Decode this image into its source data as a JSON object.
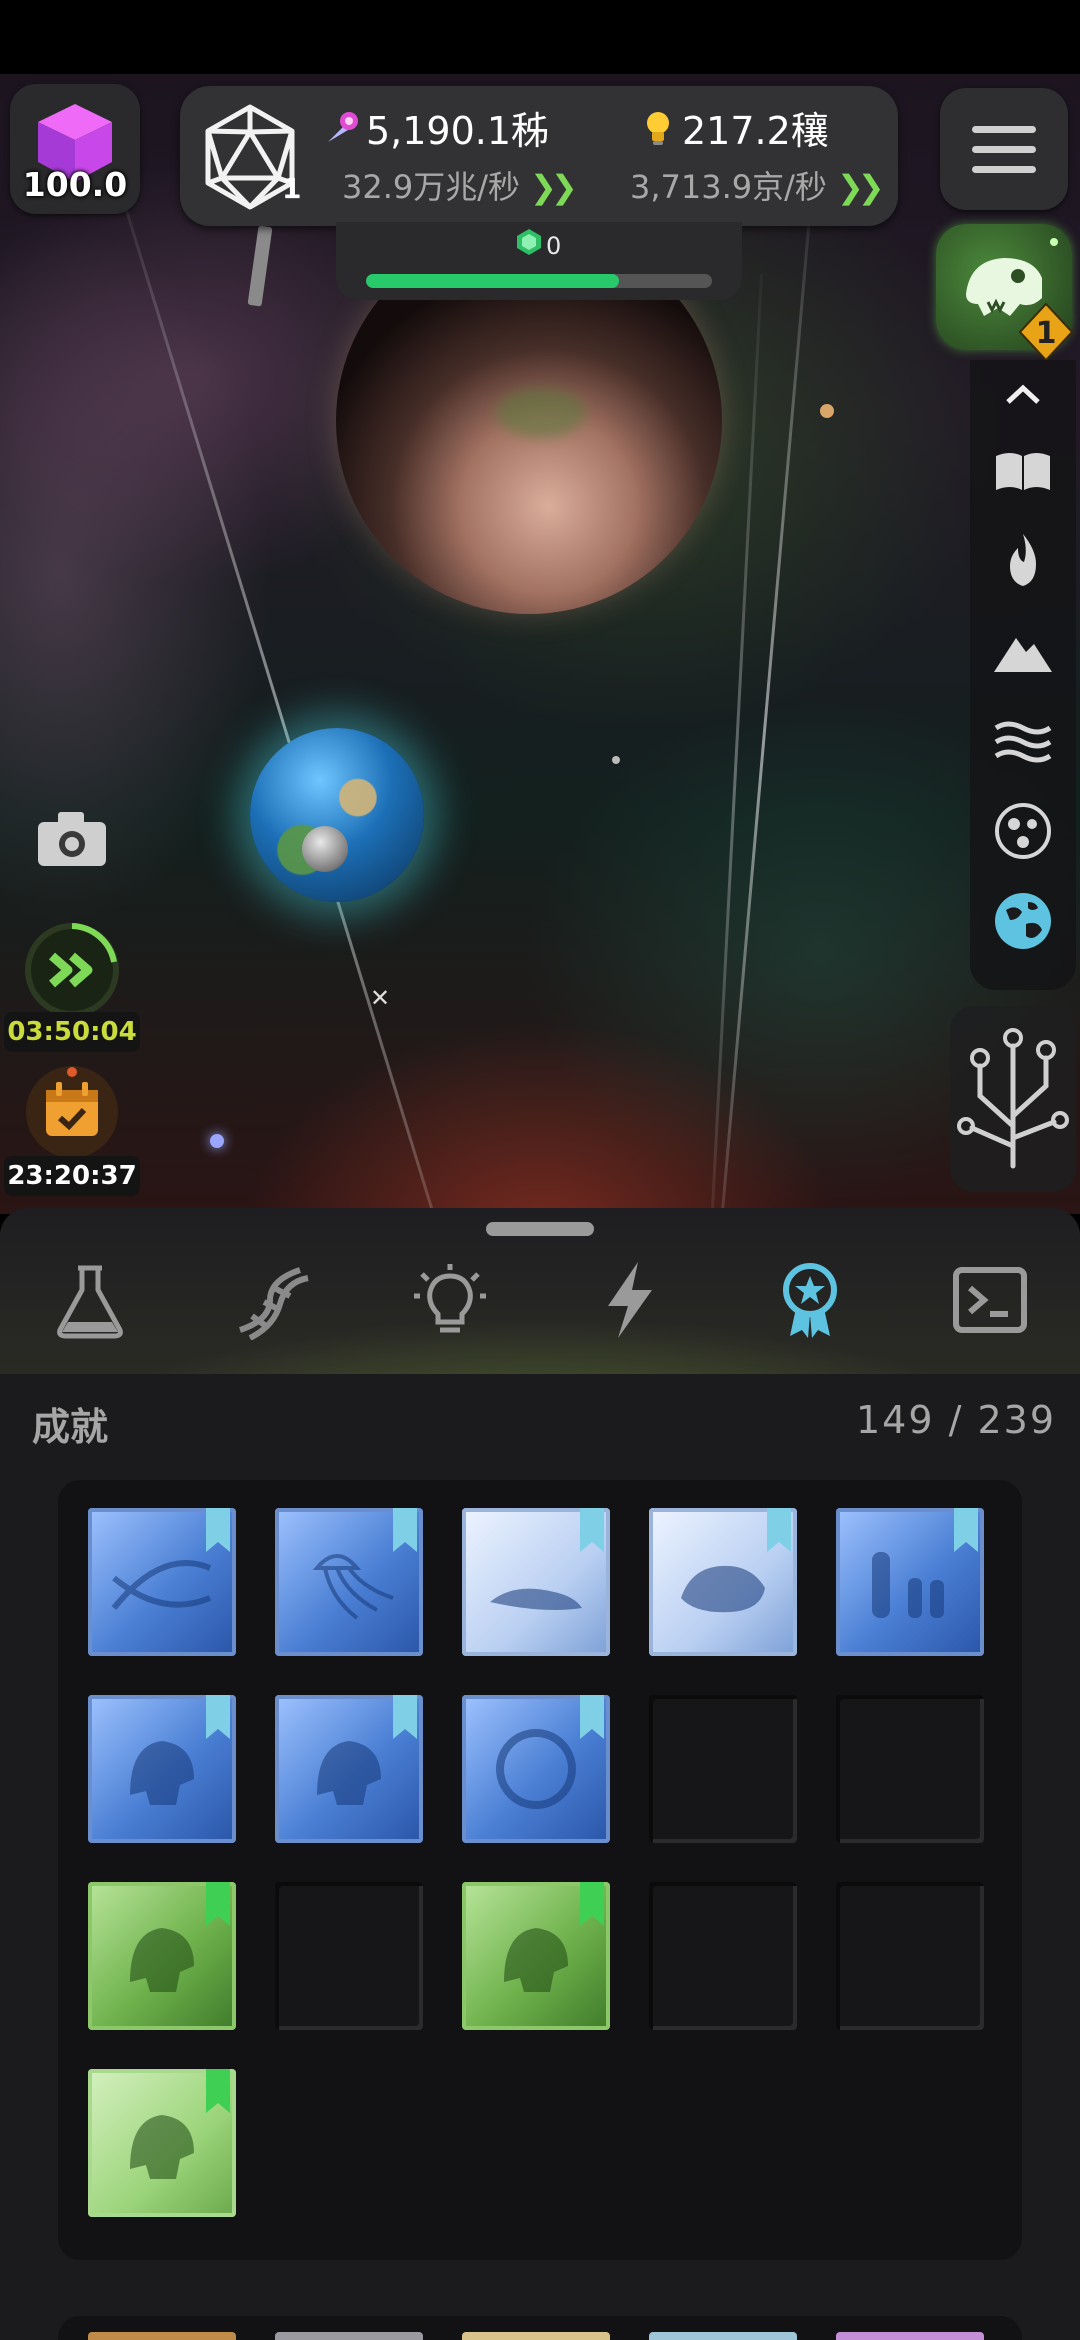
{
  "hud": {
    "cube_value": "100.0",
    "d20_level": "1",
    "resource1": {
      "amount": "5,190.1秭",
      "rate": "32.9万兆/秒"
    },
    "resource2": {
      "amount": "217.2穰",
      "rate": "3,713.9京/秒"
    },
    "gem_count": "0",
    "progress_fraction": 0.73,
    "dino_badge": "1"
  },
  "timers": {
    "boost": "03:50:04",
    "calendar": "23:20:37"
  },
  "tabs": [
    {
      "name": "research",
      "icon": "flask-icon"
    },
    {
      "name": "dna",
      "icon": "dna-icon"
    },
    {
      "name": "ideas",
      "icon": "lightbulb-icon"
    },
    {
      "name": "energy",
      "icon": "lightning-icon"
    },
    {
      "name": "achievements",
      "icon": "award-ribbon-icon",
      "active": true
    },
    {
      "name": "terminal",
      "icon": "terminal-icon"
    }
  ],
  "achievements": {
    "title": "成就",
    "count": "149 / 239",
    "tiles": [
      {
        "state": "unlocked",
        "theme": "blue",
        "art": "dna"
      },
      {
        "state": "unlocked",
        "theme": "blue",
        "art": "jellyfish"
      },
      {
        "state": "unlocked",
        "theme": "blue-light",
        "art": "whale"
      },
      {
        "state": "unlocked",
        "theme": "blue-light",
        "art": "rock"
      },
      {
        "state": "unlocked",
        "theme": "blue",
        "art": "humans"
      },
      {
        "state": "unlocked",
        "theme": "blue",
        "art": "face"
      },
      {
        "state": "unlocked",
        "theme": "blue",
        "art": "hologram-face"
      },
      {
        "state": "unlocked",
        "theme": "blue",
        "art": "planet"
      },
      {
        "state": "locked"
      },
      {
        "state": "locked"
      },
      {
        "state": "unlocked",
        "theme": "green",
        "art": "dino-skull"
      },
      {
        "state": "locked"
      },
      {
        "state": "unlocked",
        "theme": "green",
        "art": "t-rex"
      },
      {
        "state": "locked"
      },
      {
        "state": "locked"
      },
      {
        "state": "unlocked",
        "theme": "green-light",
        "art": "raptor"
      }
    ]
  },
  "colors": {
    "accent_green": "#7ed957",
    "progress_green": "#27c96b",
    "achievement_active": "#5ec3e0",
    "timer_yellow": "#c9dc3b"
  }
}
